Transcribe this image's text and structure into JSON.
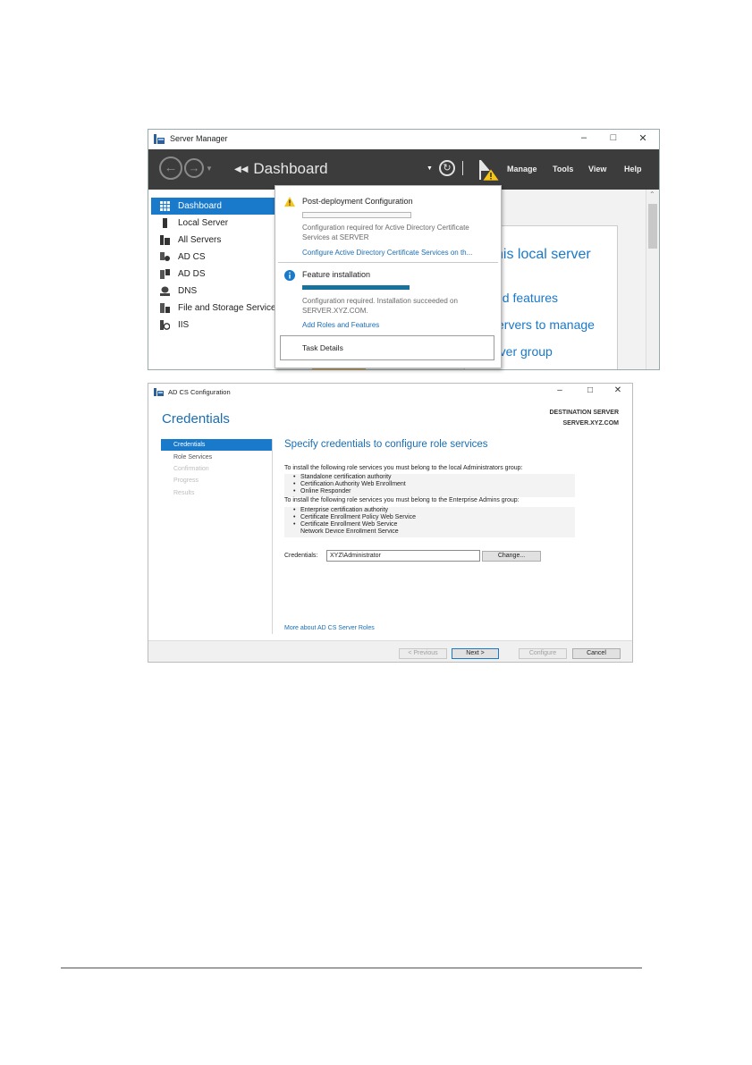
{
  "server_manager": {
    "title": "Server Manager",
    "breadcrumb": "Dashboard",
    "menu": [
      "Manage",
      "Tools",
      "View",
      "Help"
    ],
    "sidebar": [
      {
        "label": "Dashboard",
        "icon": "dashboard-grid-icon",
        "selected": true
      },
      {
        "label": "Local Server",
        "icon": "local-server-icon"
      },
      {
        "label": "All Servers",
        "icon": "all-servers-icon"
      },
      {
        "label": "AD CS",
        "icon": "adcs-icon"
      },
      {
        "label": "AD DS",
        "icon": "adds-icon"
      },
      {
        "label": "DNS",
        "icon": "dns-icon"
      },
      {
        "label": "File and Storage Service",
        "icon": "file-storage-icon"
      },
      {
        "label": "IIS",
        "icon": "iis-icon"
      }
    ],
    "content_links": [
      "his local server",
      "nd features",
      "servers to manage",
      "rver group"
    ],
    "notifications": {
      "post_deploy_title": "Post-deployment Configuration",
      "post_deploy_text": "Configuration required for Active Directory Certificate Services at SERVER",
      "post_deploy_link": "Configure Active Directory Certificate Services on th...",
      "post_deploy_progress": 0,
      "feature_title": "Feature installation",
      "feature_text": "Configuration required. Installation succeeded on SERVER.XYZ.COM.",
      "feature_link": "Add Roles and Features",
      "feature_progress": 1.0,
      "task_details": "Task Details"
    }
  },
  "adcs_config": {
    "title": "AD CS Configuration",
    "heading": "Credentials",
    "destination_label": "DESTINATION SERVER",
    "destination_value": "SERVER.XYZ.COM",
    "nav": [
      {
        "label": "Credentials",
        "state": "selected"
      },
      {
        "label": "Role Services",
        "state": "enabled"
      },
      {
        "label": "Confirmation",
        "state": "disabled"
      },
      {
        "label": "Progress",
        "state": "disabled"
      },
      {
        "label": "Results",
        "state": "disabled"
      }
    ],
    "main_title": "Specify credentials to configure role services",
    "local_admin_text": "To install the following role services you must belong to the local Administrators group:",
    "local_admin_roles": [
      "Standalone certification authority",
      "Certification Authority Web Enrollment",
      "Online Responder"
    ],
    "enterprise_admin_text": "To install the following role services you must belong to the Enterprise Admins group:",
    "enterprise_admin_roles": [
      "Enterprise certification authority",
      "Certificate Enrollment Policy Web Service",
      "Certificate Enrollment Web Service",
      "Network Device Enrollment Service"
    ],
    "credentials_label": "Credentials:",
    "credentials_value": "XYZ\\Administrator",
    "change_button": "Change...",
    "more_link": "More about AD CS Server Roles",
    "buttons": {
      "previous": "< Previous",
      "next": "Next >",
      "configure": "Configure",
      "cancel": "Cancel"
    }
  }
}
